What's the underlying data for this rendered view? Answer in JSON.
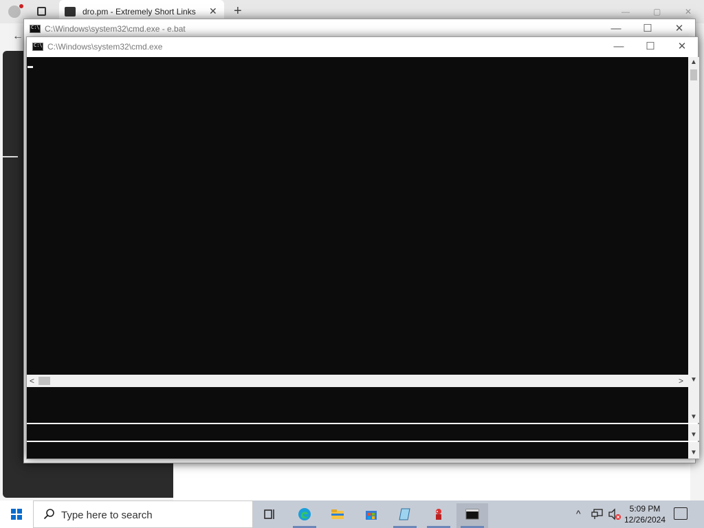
{
  "browser": {
    "tab_title": "dro.pm - Extremely Short Links",
    "tab_close": "✕",
    "new_tab": "+",
    "back": "←",
    "min": "—",
    "max": "▢",
    "close": "✕"
  },
  "windows": {
    "back_window": {
      "title": "C:\\Windows\\system32\\cmd.exe - e.bat",
      "min": "—",
      "max": "☐",
      "close": "✕"
    },
    "front_window": {
      "title": "C:\\Windows\\system32\\cmd.exe",
      "min": "—",
      "max": "☐",
      "close": "✕"
    }
  },
  "scroll": {
    "up": "▲",
    "down": "▼",
    "left": "<",
    "right": ">"
  },
  "taskbar": {
    "search_placeholder": "Type here to search",
    "search_icon": "search-icon",
    "apps": [
      "task-view-icon",
      "edge-icon",
      "file-explorer-icon",
      "store-icon",
      "notepad-icon",
      "game-icon",
      "cmd-icon"
    ],
    "clock_time": "5:09 PM",
    "clock_date": "12/26/2024",
    "tray_chevron": "^"
  },
  "colors": {
    "console_bg": "#0c0c0c",
    "taskbar_bg": "#c6ccd6",
    "start_blue": "#0a6ccc"
  }
}
